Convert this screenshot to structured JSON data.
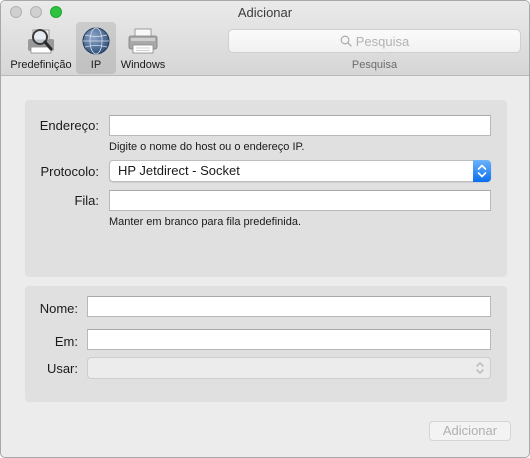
{
  "window": {
    "title": "Adicionar"
  },
  "toolbar": {
    "items": [
      {
        "label": "Predefinição",
        "icon": "default-printer-icon"
      },
      {
        "label": "IP",
        "icon": "globe-icon",
        "selected": true
      },
      {
        "label": "Windows",
        "icon": "windows-printer-icon"
      }
    ],
    "search": {
      "placeholder": "Pesquisa",
      "caption": "Pesquisa"
    }
  },
  "connection": {
    "address_label": "Endereço:",
    "address_value": "",
    "address_hint": "Digite o nome do host ou o endereço IP.",
    "protocol_label": "Protocolo:",
    "protocol_value": "HP Jetdirect - Socket",
    "queue_label": "Fila:",
    "queue_value": "",
    "queue_hint": "Manter em branco para fila predefinida."
  },
  "printer": {
    "name_label": "Nome:",
    "name_value": "",
    "location_label": "Em:",
    "location_value": "",
    "use_label": "Usar:",
    "use_value": ""
  },
  "actions": {
    "add_label": "Adicionar"
  },
  "colors": {
    "accent": "#0a6ff2",
    "traffic_zoom": "#2fc240"
  }
}
